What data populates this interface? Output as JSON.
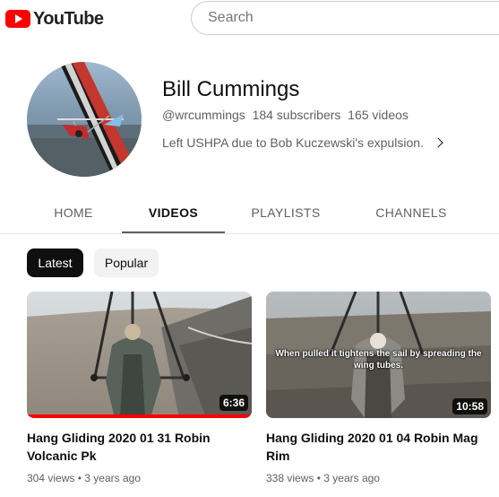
{
  "header": {
    "logo_text": "YouTube",
    "search_placeholder": "Search"
  },
  "channel": {
    "name": "Bill Cummings",
    "handle": "@wrcummings",
    "subscribers": "184 subscribers",
    "videos_count": "165 videos",
    "description": "Left USHPA due to Bob Kuczewski's expulsion."
  },
  "tabs": [
    {
      "label": "HOME",
      "active": false
    },
    {
      "label": "VIDEOS",
      "active": true
    },
    {
      "label": "PLAYLISTS",
      "active": false
    },
    {
      "label": "CHANNELS",
      "active": false
    }
  ],
  "chips": [
    {
      "label": "Latest",
      "selected": true
    },
    {
      "label": "Popular",
      "selected": false
    }
  ],
  "videos": [
    {
      "title": "Hang Gliding 2020 01 31 Robin Volcanic Pk",
      "views": "304 views",
      "age": "3 years ago",
      "duration": "6:36",
      "watched_fraction": 1.0,
      "caption": ""
    },
    {
      "title": "Hang Gliding 2020 01 04 Robin Mag Rim",
      "views": "338 views",
      "age": "3 years ago",
      "duration": "10:58",
      "watched_fraction": 0,
      "caption": "When pulled it tightens the sail by spreading the wing tubes."
    }
  ],
  "meta_separator": "•"
}
